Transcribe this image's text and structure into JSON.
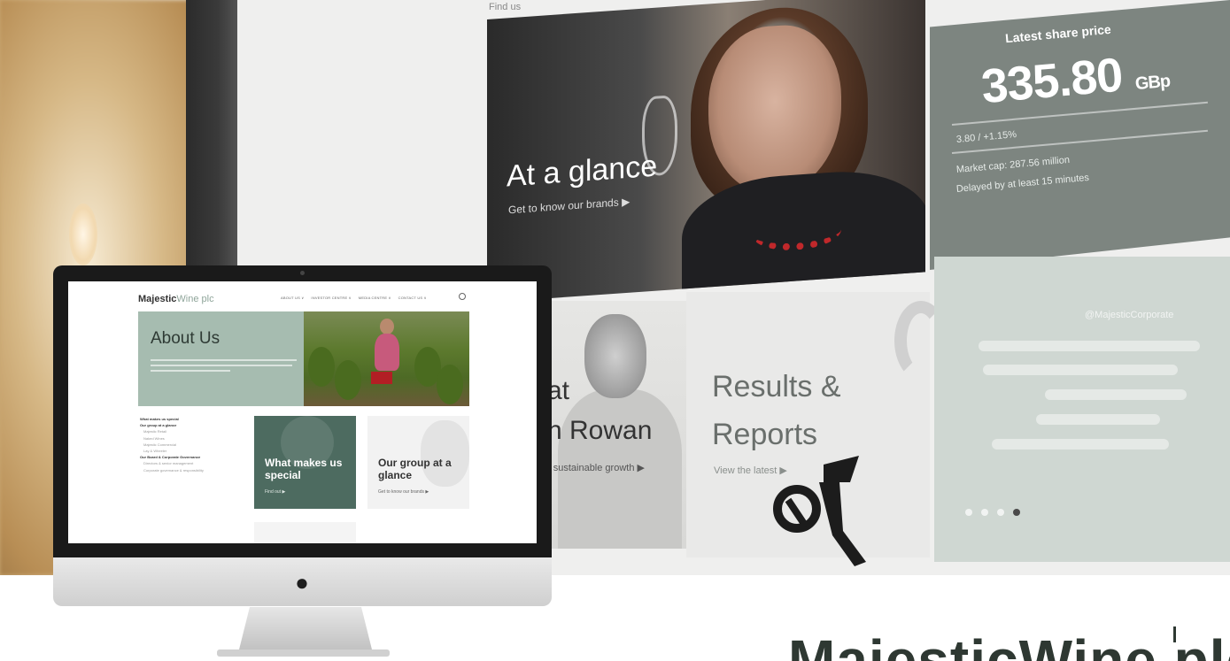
{
  "background_site": {
    "top_text": "Find us",
    "glance": {
      "title": "At a glance",
      "subtitle": "Get to know our brands ▶"
    },
    "share": {
      "label": "Latest share price",
      "price": "335.80",
      "unit": "GBp",
      "change": "3.80 / +1.15%",
      "volume": "Market cap: 287.56 million",
      "delayed": "Delayed by at least 15 minutes"
    },
    "rowan": {
      "line1": "at",
      "line2": "n Rowan",
      "subtitle": "r sustainable growth ▶"
    },
    "results": {
      "line1": "Results &",
      "line2": "Reports",
      "subtitle": "View the latest ▶"
    },
    "twitter": {
      "handle": "@MajesticCorporate",
      "slider_dots": 4,
      "active_dot": 3
    }
  },
  "imac_site": {
    "logo_main": "Majestic",
    "logo_accent": "Wine plc",
    "nav": [
      "ABOUT US ∨",
      "INVESTOR CENTRE ∨",
      "MEDIA CENTRE ∨",
      "CONTACT US ∨"
    ],
    "hero_title": "About Us",
    "side_menu": [
      {
        "label": "What makes us special",
        "type": "bold"
      },
      {
        "label": "Our group at a glance",
        "type": "bold"
      },
      {
        "label": "Majestic Retail",
        "type": "sub"
      },
      {
        "label": "Naked Wines",
        "type": "sub"
      },
      {
        "label": "Majestic Commercial",
        "type": "sub"
      },
      {
        "label": "Lay & Wheeler",
        "type": "sub"
      },
      {
        "label": "Our Board & Corporate Governance",
        "type": "bold"
      },
      {
        "label": "Directors & senior management",
        "type": "sub"
      },
      {
        "label": "Corporate governance & responsibility",
        "type": "sub"
      }
    ],
    "tile_special": {
      "title": "What makes us special",
      "subtitle": "Find out ▶"
    },
    "tile_group": {
      "title": "Our group at a glance",
      "subtitle": "Get to know our brands ▶"
    }
  },
  "wordmark": "MajesticWine plc",
  "colors": {
    "sage": "#a6bcb0",
    "dark_green": "#4d6b60",
    "share_grey": "#7d8580"
  }
}
